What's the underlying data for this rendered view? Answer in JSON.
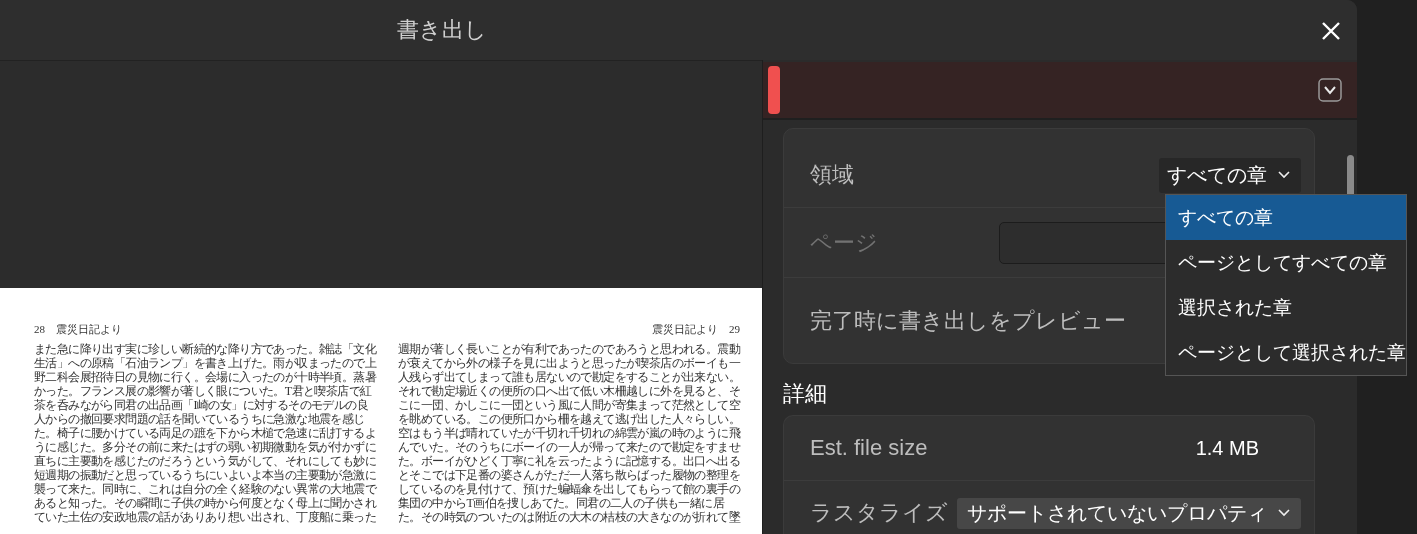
{
  "window": {
    "title": "書き出し"
  },
  "preview": {
    "pages": [
      {
        "header": "28　震災日記より",
        "lines": [
          "また急に降り出す実に珍しい断続的な降り方であった。雑誌「文化",
          "生活」への原稿「石油ランプ」を書き上げた。雨が収まったので上",
          "野二科会展招待日の見物に行く。会場に入ったのが十時半頃。蒸暑",
          "かった。フランス展の影響が著しく眼についた。T君と喫茶店で紅",
          "茶を呑みながら同君の出品画「I崎の女」に対するそのモデルの良",
          "人からの撤回要求問題の話を聞いているうちに急激な地震を感じ",
          "た。椅子に腰かけている両足の蹠を下から木槌で急速に乱打するよ",
          "うに感じた。多分その前に来たはずの弱い初期微動を気が付かずに",
          "直ちに主要動を感じたのだろうという気がして、それにしても妙に",
          "短週期の振動だと思っているうちにいよいよ本当の主要動が急激に",
          "襲って来た。同時に、これは自分の全く経験のない異常の大地震で",
          "あると知った。その瞬間に子供の時から何度となく母上に聞かされ",
          "ていた土佐の安政地震の話がありあり想い出され、丁度船に乗った"
        ]
      },
      {
        "header": "震災日記より　29",
        "lines": [
          "週期が著しく長いことが有利であったのであろうと思われる。震動",
          "が衰えてから外の様子を見に出ようと思ったが喫茶店のボーイも一",
          "人残らず出てしまって誰も居ないので勘定をすることが出来ない。",
          "それで勘定場近くの便所の口へ出て低い木柵越しに外を見ると、そ",
          "こに一団、かしこに一団という風に人間が寄集まって茫然として空",
          "を眺めている。この便所口から柵を越えて逃げ出した人々らしい。",
          "空はもう半ば晴れていたが千切れ千切れの綿雲が嵐の時のように飛",
          "んでいた。そのうちにボーイの一人が帰って来たので勘定をすませ",
          "た。ボーイがひどく丁寧に礼を云ったように記憶する。出口へ出る",
          "とそこでは下足番の婆さんがただ一人落ち散らばった履物の整理を",
          "しているのを見付けて、預けた蝙蝠傘を出してもらって館の裏手の",
          "集団の中からT画伯を捜しあてた。同君の二人の子供も一緒に居",
          "た。その時気のついたのは附近の大木の桔枝の大きなのが折れて墜"
        ]
      }
    ]
  },
  "settings": {
    "rows": [
      {
        "kind": "dropdown",
        "label": "領域",
        "value": "すべての章",
        "disabled": false
      },
      {
        "kind": "field",
        "label": "ページ",
        "disabled": true
      },
      {
        "kind": "plain",
        "label": "完了時に書き出しをプレビュー",
        "disabled": false
      }
    ]
  },
  "menu": [
    {
      "label": "すべての章",
      "selected": true
    },
    {
      "label": "ページとしてすべての章",
      "selected": false
    },
    {
      "label": "選択された章",
      "selected": false
    },
    {
      "label": "ページとして選択された章",
      "selected": false
    }
  ],
  "details": {
    "title": "詳細",
    "rows": [
      {
        "kind": "value",
        "label": "Est. file size",
        "value": "1.4 MB"
      },
      {
        "kind": "dropdown",
        "label": "ラスタライズ",
        "value": "サポートされていないプロパティ"
      }
    ]
  }
}
